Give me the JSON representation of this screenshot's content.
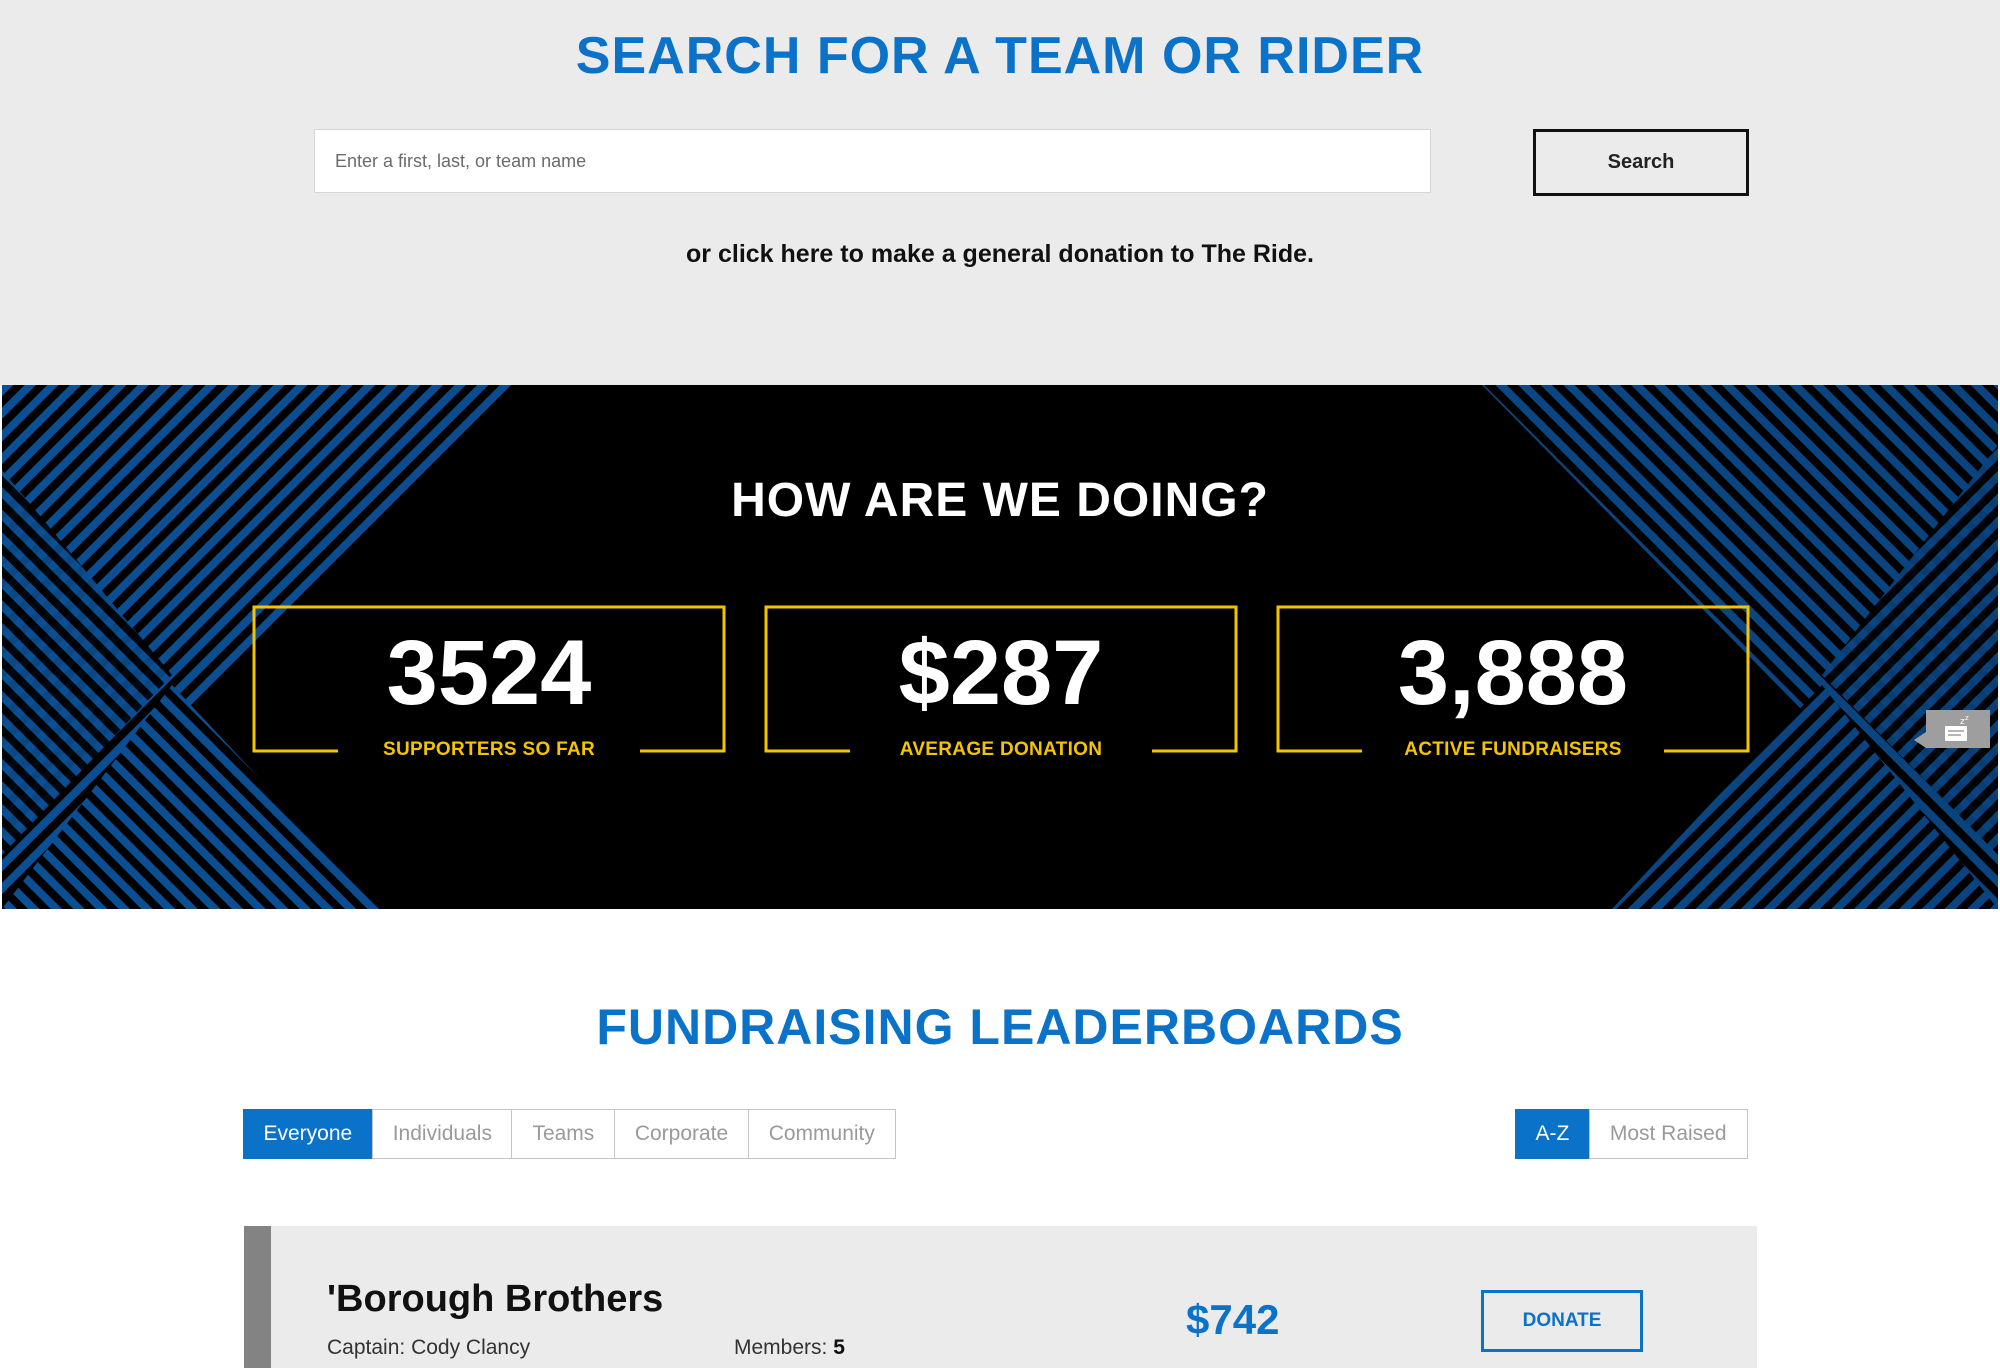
{
  "search": {
    "title": "SEARCH FOR A TEAM OR RIDER",
    "placeholder": "Enter a first, last, or team name",
    "button_label": "Search",
    "general_donation_text": "or click here to make a general donation to The Ride."
  },
  "stats": {
    "title": "HOW ARE WE DOING?",
    "items": [
      {
        "value": "3524",
        "label": "SUPPORTERS SO FAR"
      },
      {
        "value": "$287",
        "label": "AVERAGE DONATION"
      },
      {
        "value": "3,888",
        "label": "ACTIVE FUNDRAISERS"
      }
    ],
    "frame_color": "#f5c400",
    "pattern_color": "#0b4f94"
  },
  "leaderboard": {
    "title": "FUNDRAISING LEADERBOARDS",
    "filter_tabs": [
      "Everyone",
      "Individuals",
      "Teams",
      "Corporate",
      "Community"
    ],
    "active_filter": "Everyone",
    "sort_tabs": [
      "A-Z",
      "Most Raised"
    ],
    "active_sort": "A-Z",
    "teams": [
      {
        "name": "'Borough Brothers",
        "captain_label": "Captain:",
        "captain_name": "Cody Clancy",
        "members_label": "Members:",
        "members_count": "5",
        "amount": "$742",
        "donate_label": "DONATE"
      }
    ]
  },
  "colors": {
    "accent": "#0a72c8",
    "gold": "#f5c400",
    "gray_bg": "#ebebeb"
  },
  "chat_widget": {
    "icon": "chat-sleep-icon"
  }
}
